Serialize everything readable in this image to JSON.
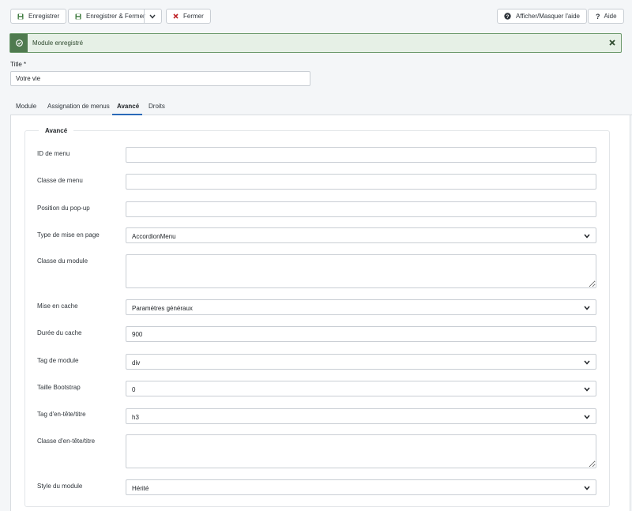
{
  "toolbar": {
    "save_label": "Enregistrer",
    "save_close_label": "Enregistrer & Fermer",
    "close_label": "Fermer",
    "help_toggle_label": "Afficher/Masquer l'aide",
    "help_label": "Aide"
  },
  "alert": {
    "message": "Module enregistré"
  },
  "title_field": {
    "label": "Title *",
    "value": "Votre vie"
  },
  "tabs": [
    {
      "label": "Module",
      "active": false
    },
    {
      "label": "Assignation de menus",
      "active": false
    },
    {
      "label": "Avancé",
      "active": true
    },
    {
      "label": "Droits",
      "active": false
    }
  ],
  "fieldset": {
    "legend": "Avancé",
    "fields": {
      "menu_id": {
        "label": "ID de menu",
        "value": ""
      },
      "menu_class": {
        "label": "Classe de menu",
        "value": ""
      },
      "popup_position": {
        "label": "Position du pop-up",
        "value": ""
      },
      "layout_type": {
        "label": "Type de mise en page",
        "value": "AccordionMenu"
      },
      "module_class": {
        "label": "Classe du module",
        "value": ""
      },
      "caching": {
        "label": "Mise en cache",
        "value": "Paramètres généraux"
      },
      "cache_time": {
        "label": "Durée du cache",
        "value": "900"
      },
      "module_tag": {
        "label": "Tag de module",
        "value": "div"
      },
      "bootstrap_size": {
        "label": "Taille Bootstrap",
        "value": "0"
      },
      "header_tag": {
        "label": "Tag d'en-tête/titre",
        "value": "h3"
      },
      "header_class": {
        "label": "Classe d'en-tête/titre",
        "value": ""
      },
      "module_style": {
        "label": "Style du module",
        "value": "Hérité"
      }
    }
  },
  "colors": {
    "alert_bg": "#e6f0e6",
    "alert_border": "#6d9a6d",
    "alert_badge": "#4f7a4f",
    "save_icon": "#3d7a3d",
    "close_icon": "#c0282d",
    "tab_active_border": "#2a69b8"
  },
  "icons": {
    "save": "save-icon",
    "dropdown": "chevron-down-icon",
    "close": "close-icon",
    "help_toggle": "question-circle-icon",
    "help": "question-icon",
    "alert": "check-circle-icon",
    "alert_close": "close-icon"
  }
}
